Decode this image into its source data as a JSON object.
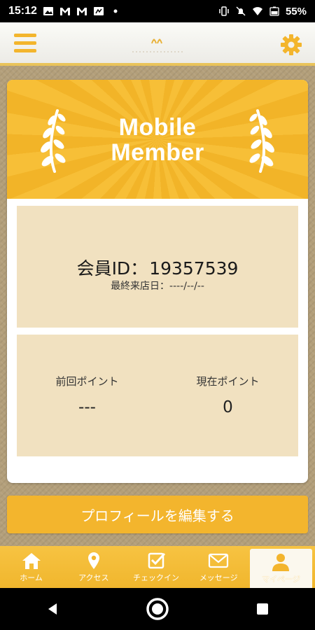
{
  "status_bar": {
    "time": "15:12",
    "battery": "55%",
    "left_icons": [
      "image-icon",
      "gmail-icon",
      "gmail-icon",
      "notification-icon",
      "dot-icon"
    ],
    "right_icons": [
      "vibrate-icon",
      "mute-icon",
      "wifi-icon",
      "battery-icon"
    ]
  },
  "header": {
    "menu_icon": "hamburger-icon",
    "settings_icon": "gear-icon",
    "accent_color": "#f3b52d"
  },
  "card": {
    "banner_title_line1": "Mobile",
    "banner_title_line2": "Member",
    "member_id_label": "会員ID：",
    "member_id": "19357539",
    "last_visit": "最終来店日：----/--/--",
    "points": {
      "previous_label": "前回ポイント",
      "previous_value": "---",
      "current_label": "現在ポイント",
      "current_value": "0"
    }
  },
  "edit_profile_button": "プロフィールを編集する",
  "tabs": [
    {
      "label": "ホーム",
      "icon": "home-icon",
      "active": false
    },
    {
      "label": "アクセス",
      "icon": "map-pin-icon",
      "active": false
    },
    {
      "label": "チェックイン",
      "icon": "checkbox-icon",
      "active": false
    },
    {
      "label": "メッセージ",
      "icon": "envelope-icon",
      "active": false
    },
    {
      "label": "マイページ",
      "icon": "person-icon",
      "active": true
    }
  ],
  "nav_bar": {
    "buttons": [
      "back-icon",
      "home-icon",
      "recents-icon"
    ]
  }
}
